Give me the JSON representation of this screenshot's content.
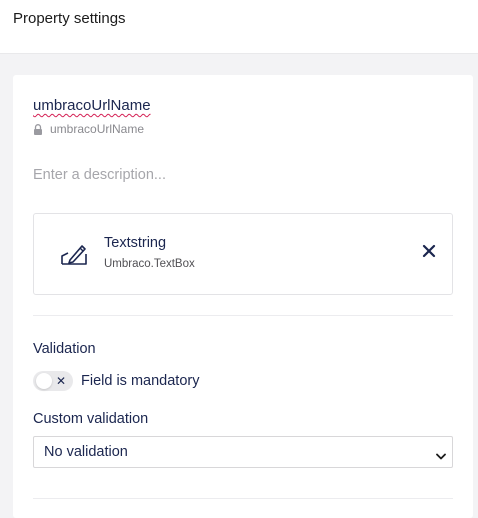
{
  "header": {
    "title": "Property settings"
  },
  "property": {
    "name": "umbracoUrlName",
    "alias": "umbracoUrlName",
    "alias_icon": "lock-icon",
    "description_placeholder": "Enter a description..."
  },
  "editor": {
    "icon": "pencil-icon",
    "name": "Textstring",
    "alias": "Umbraco.TextBox",
    "remove_icon": "close-icon"
  },
  "validation": {
    "heading": "Validation",
    "mandatory_label": "Field is mandatory",
    "mandatory_toggle_icon": "close-icon",
    "mandatory_enabled": false,
    "custom_label": "Custom validation",
    "custom_selected": "No validation"
  },
  "colors": {
    "text_primary": "#1b264f",
    "invalid_underline": "#d42054",
    "page_background": "#f3f3f5"
  }
}
